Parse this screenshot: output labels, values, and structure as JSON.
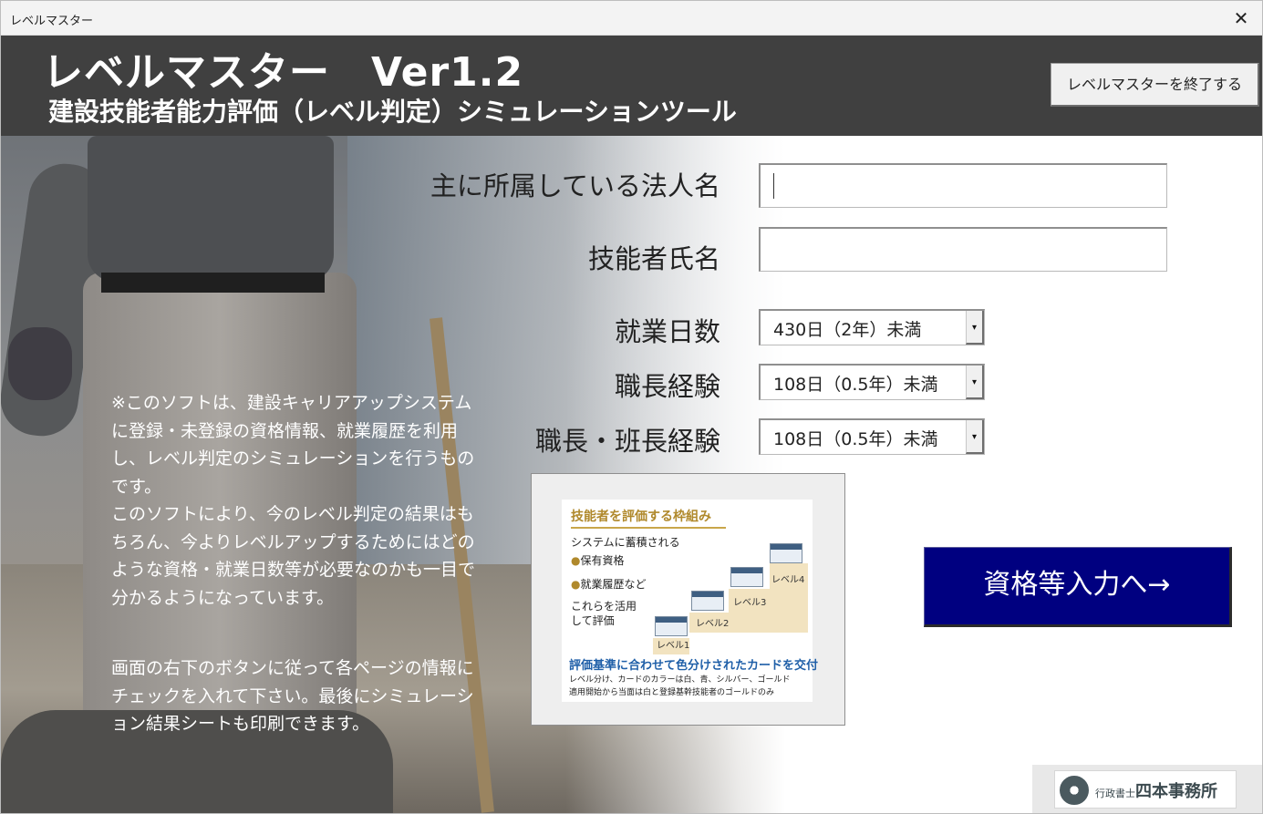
{
  "window": {
    "title": "レベルマスター",
    "close_glyph": "✕"
  },
  "header": {
    "title": "レベルマスター　Ver1.2",
    "subtitle": "建設技能者能力評価（レベル判定）シミュレーションツール",
    "exit_label": "レベルマスターを終了する"
  },
  "description": {
    "para1": "※このソフトは、建設キャリアアップシステムに登録・未登録の資格情報、就業履歴を利用し、レベル判定のシミュレーションを行うものです。\nこのソフトにより、今のレベル判定の結果はもちろん、今よりレベルアップするためにはどのような資格・就業日数等が必要なのかも一目で分かるようになっています。",
    "para2": "画面の右下のボタンに従って各ページの情報にチェックを入れて下さい。最後にシミュレーション結果シートも印刷できます。"
  },
  "form": {
    "corporation_label": "主に所属している法人名",
    "corporation_value": "",
    "worker_name_label": "技能者氏名",
    "worker_name_value": "",
    "work_days_label": "就業日数",
    "work_days_value": "430日（2年）未満",
    "foreman_label": "職長経験",
    "foreman_value": "108日（0.5年）未満",
    "foreman_leader_label": "職長・班長経験",
    "foreman_leader_value": "108日（0.5年）未満",
    "dropdown_glyph": "▾"
  },
  "framework_image": {
    "title": "技能者を評価する枠組み",
    "line1": "システムに蓄積される",
    "line2": "保有資格",
    "line3": "就業履歴など",
    "line4": "これらを活用",
    "line5": "して評価",
    "bullet": "●",
    "level1": "レベル1",
    "level2": "レベル2",
    "level3": "レベル3",
    "level4": "レベル4",
    "blue_heading": "評価基準に合わせて色分けされたカードを交付",
    "small1": "レベル分け、カードのカラーは白、青、シルバー、ゴールド",
    "small2": "適用開始から当面は白と登録基幹技能者のゴールドのみ"
  },
  "next_button": {
    "label": "資格等入力へ→"
  },
  "office_logo": {
    "prefix": "行政書士",
    "name": "四本事務所"
  },
  "colors": {
    "header_bg": "#404040",
    "next_bg": "#000080",
    "gold": "#b0892c",
    "blue": "#1f5fa8"
  }
}
